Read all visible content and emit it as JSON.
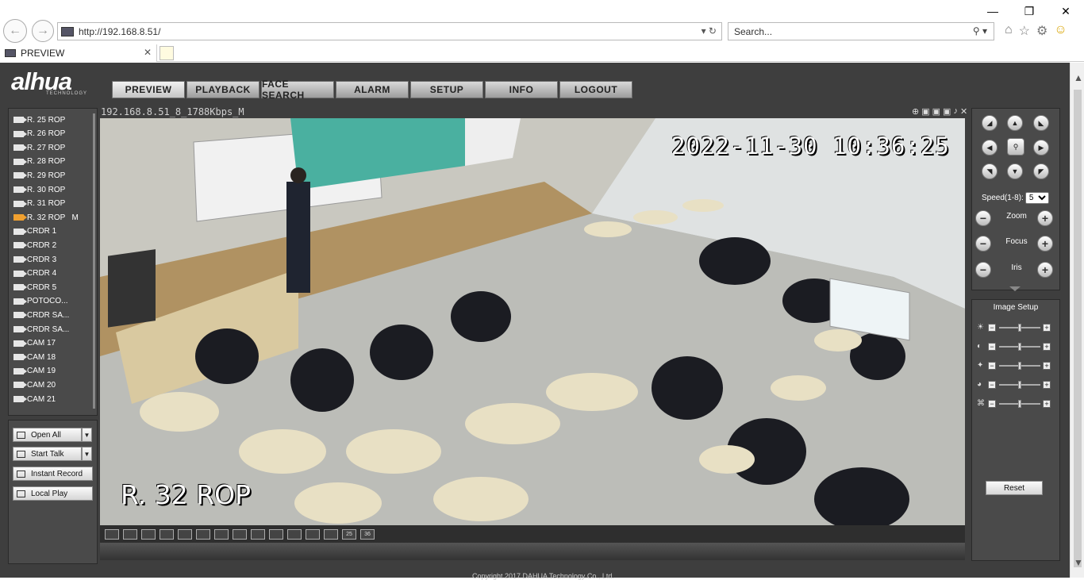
{
  "browser": {
    "url": "http://192.168.8.51/",
    "search_placeholder": "Search...",
    "tab_title": "PREVIEW"
  },
  "app": {
    "logo": "alhua",
    "logo_sub": "TECHNOLOGY",
    "menu": [
      "PREVIEW",
      "PLAYBACK",
      "FACE SEARCH",
      "ALARM",
      "SETUP",
      "INFO",
      "LOGOUT"
    ],
    "active_menu": "PREVIEW"
  },
  "channels": [
    {
      "label": "R. 25 ROP",
      "active": false
    },
    {
      "label": "R. 26 ROP",
      "active": false
    },
    {
      "label": "R. 27 ROP",
      "active": false
    },
    {
      "label": "R. 28 ROP",
      "active": false
    },
    {
      "label": "R. 29 ROP",
      "active": false
    },
    {
      "label": "R. 30 ROP",
      "active": false
    },
    {
      "label": "R. 31 ROP",
      "active": false
    },
    {
      "label": "R. 32 ROP   M",
      "active": true
    },
    {
      "label": "CRDR 1",
      "active": false
    },
    {
      "label": "CRDR 2",
      "active": false
    },
    {
      "label": "CRDR 3",
      "active": false
    },
    {
      "label": "CRDR 4",
      "active": false
    },
    {
      "label": "CRDR 5",
      "active": false
    },
    {
      "label": "POTOCO...",
      "active": false
    },
    {
      "label": "CRDR SA...",
      "active": false
    },
    {
      "label": "CRDR SA...",
      "active": false
    },
    {
      "label": "CAM 17",
      "active": false
    },
    {
      "label": "CAM 18",
      "active": false
    },
    {
      "label": "CAM 19",
      "active": false
    },
    {
      "label": "CAM 20",
      "active": false
    },
    {
      "label": "CAM 21",
      "active": false
    }
  ],
  "left_buttons": {
    "open_all": "Open All",
    "start_talk": "Start Talk",
    "instant_record": "Instant Record",
    "local_play": "Local Play"
  },
  "video": {
    "stream_title": "192.168.8.51_8_1788Kbps_M",
    "osd_time": "2022-11-30 10:36:25",
    "osd_name": "R. 32 ROP"
  },
  "layouts": [
    "1",
    "2",
    "3",
    "4",
    "5",
    "6",
    "7",
    "8",
    "9",
    "10",
    "11",
    "12",
    "13",
    "25",
    "36"
  ],
  "ptz": {
    "speed_label": "Speed(1-8):",
    "speed_value": "5",
    "zoom": "Zoom",
    "focus": "Focus",
    "iris": "Iris"
  },
  "image_setup": {
    "title": "Image Setup",
    "reset": "Reset",
    "sliders": [
      {
        "icon": "brightness-icon",
        "level": 0.5
      },
      {
        "icon": "contrast-icon",
        "level": 0.5
      },
      {
        "icon": "saturation-icon",
        "level": 0.5
      },
      {
        "icon": "gamma-icon",
        "level": 0.5
      },
      {
        "icon": "hue-icon",
        "level": 0.5
      }
    ]
  },
  "footer": "Copyright 2017 DAHUA Technology Co., Ltd."
}
